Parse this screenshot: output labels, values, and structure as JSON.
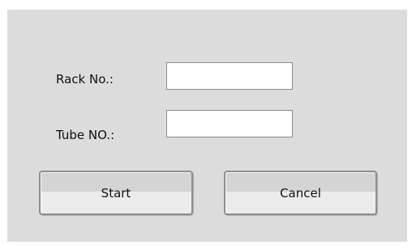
{
  "form": {
    "rack_label": "Rack No.:",
    "rack_value": "",
    "tube_label": "Tube NO.:",
    "tube_value": ""
  },
  "actions": {
    "start_label": "Start",
    "cancel_label": "Cancel"
  },
  "colors": {
    "dialog_background": "#dcdcdc",
    "input_background": "#ffffff",
    "button_border": "#8e8e8e"
  }
}
